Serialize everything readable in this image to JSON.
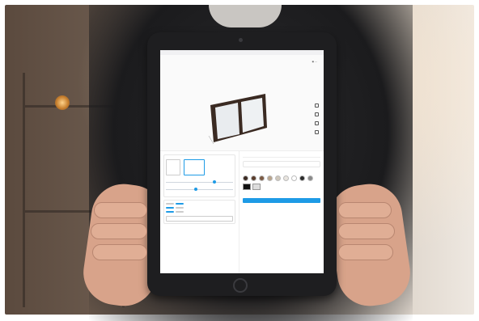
{
  "screen": {
    "address": "",
    "tabs": [
      "",
      "",
      ""
    ],
    "buy_label": "",
    "swatch_colors": [
      "#3b2a22",
      "#5a3d2c",
      "#7b5a43",
      "#b9a48c",
      "#cfc7bb",
      "#e9e5df",
      "#ffffff",
      "#2b2b2b",
      "#8a8a8a"
    ],
    "accent_color": "#1e9be6",
    "frame_color": "#3a2a22"
  }
}
